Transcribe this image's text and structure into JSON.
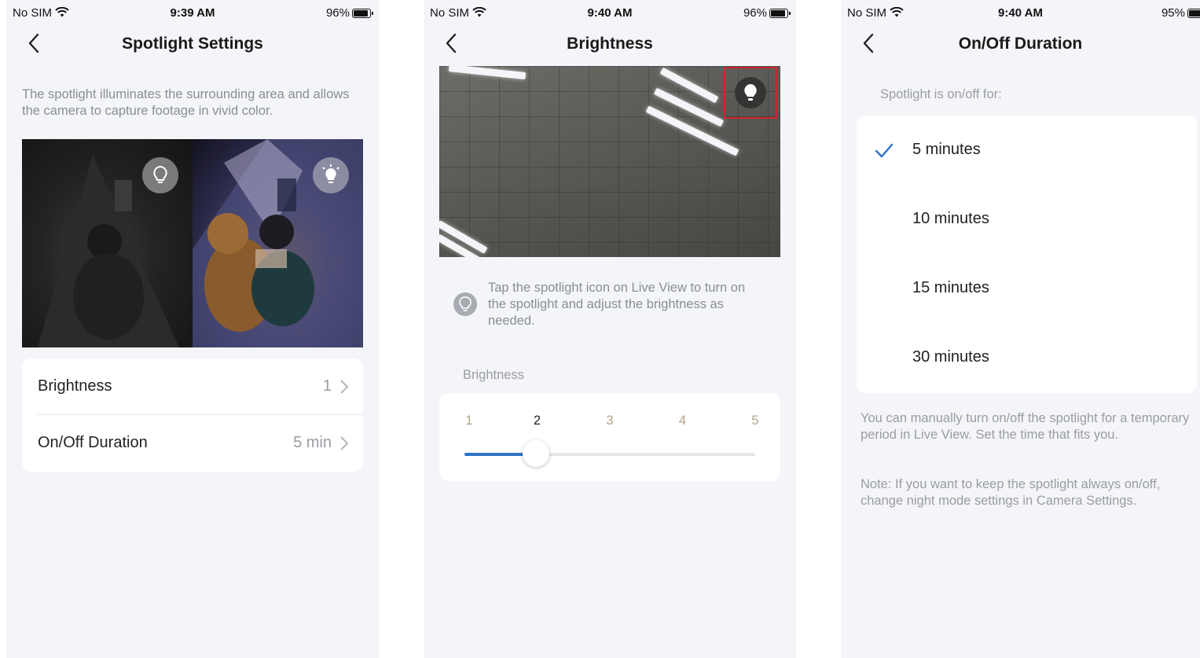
{
  "status_bars": [
    {
      "carrier": "No SIM",
      "time": "9:39 AM",
      "battery": "96%",
      "battery_level": 0.96
    },
    {
      "carrier": "No SIM",
      "time": "9:40 AM",
      "battery": "96%",
      "battery_level": 0.96
    },
    {
      "carrier": "No SIM",
      "time": "9:40 AM",
      "battery": "95%",
      "battery_level": 0.95
    }
  ],
  "spotlight_settings": {
    "title": "Spotlight Settings",
    "description": "The spotlight illuminates the surrounding area and allows the camera to capture footage in vivid color.",
    "rows": [
      {
        "label": "Brightness",
        "value": "1"
      },
      {
        "label": "On/Off Duration",
        "value": "5 min"
      }
    ]
  },
  "brightness": {
    "title": "Brightness",
    "tip": "Tap the spotlight icon on Live View to turn on the spotlight and adjust the brightness as needed.",
    "section_label": "Brightness",
    "levels": [
      "1",
      "2",
      "3",
      "4",
      "5"
    ],
    "selected_level": 2,
    "accent_color": "#2d73c7",
    "highlight_color": "#d0232c"
  },
  "duration": {
    "title": "On/Off Duration",
    "section_label": "Spotlight is on/off for:",
    "options": [
      "5 minutes",
      "10 minutes",
      "15 minutes",
      "30 minutes"
    ],
    "selected_index": 0,
    "note1": "You can manually turn on/off the spotlight for a temporary period in Live View. Set the time that fits you.",
    "note2": "Note: If you want to keep the spotlight always on/off, change night mode settings in Camera Settings."
  }
}
